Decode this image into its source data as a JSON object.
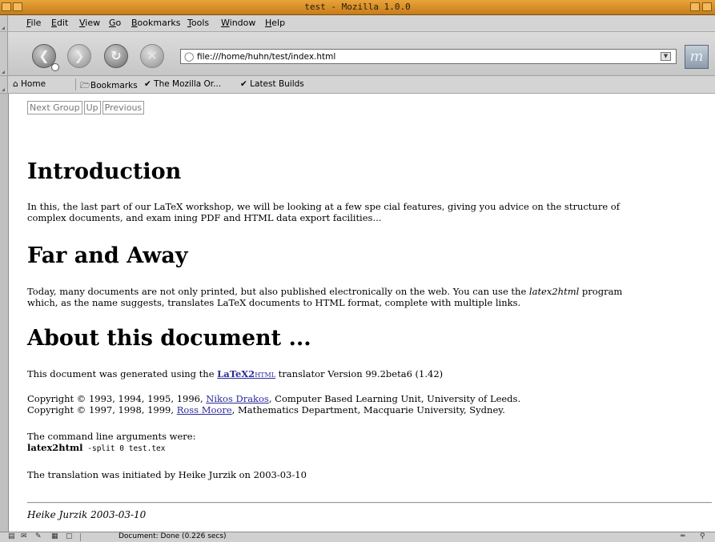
{
  "window": {
    "title": "test - Mozilla 1.0.0"
  },
  "menu": [
    "File",
    "Edit",
    "View",
    "Go",
    "Bookmarks",
    "Tools",
    "Window",
    "Help"
  ],
  "menu_mnemonics": [
    "F",
    "E",
    "V",
    "G",
    "B",
    "T",
    "W",
    "H"
  ],
  "nav": {
    "back_icon": "back-arrow-icon",
    "forward_icon": "forward-arrow-icon",
    "reload_icon": "reload-icon",
    "stop_icon": "stop-icon",
    "url": "file:///home/huhn/test/index.html"
  },
  "personal_toolbar": {
    "home": "Home",
    "bookmarks": "Bookmarks",
    "mozilla_org": "The Mozilla Or...",
    "latest_builds": "Latest Builds"
  },
  "page": {
    "navlinks": {
      "next_group": "Next Group",
      "up": "Up",
      "previous": "Previous"
    },
    "sections": [
      {
        "heading": "Introduction",
        "text_lines": [
          "In this, the last part of our LaTeX workshop, we will be looking at a few spe cial features, giving you advice on the structure of",
          "complex documents, and exam ining PDF and HTML data export facilities..."
        ]
      },
      {
        "heading": "Far and Away",
        "text_line1_pre": "Today, many documents are not only printed, but also published electronically on the web. You can use the ",
        "text_line1_em": "latex2html",
        "text_line1_post": " program",
        "text_line2": "which, as the name suggests, translates LaTeX documents to HTML format, complete with multiple links."
      },
      {
        "heading": "About this document ...",
        "generated_pre": "This document was generated using the ",
        "latex2html_link": "LaTeX2",
        "latex2html_link_sub": "HTML",
        "generated_post": " translator Version 99.2beta6 (1.42)",
        "copyright1_pre": "Copyright © 1993, 1994, 1995, 1996, ",
        "copyright1_link": "Nikos Drakos",
        "copyright1_post": ", Computer Based Learning Unit, University of Leeds.",
        "copyright2_pre": "Copyright © 1997, 1998, 1999, ",
        "copyright2_link": "Ross Moore",
        "copyright2_post": ", Mathematics Department, Macquarie University, Sydney.",
        "args_label": "The command line arguments were:",
        "args_cmd": "latex2html",
        "args_params": " -split 0 test.tex",
        "translation": "The translation was initiated by Heike Jurzik on 2003-03-10"
      }
    ],
    "address": "Heike Jurzik 2003-03-10"
  },
  "status": {
    "text": "Document: Done (0.226 secs)"
  }
}
